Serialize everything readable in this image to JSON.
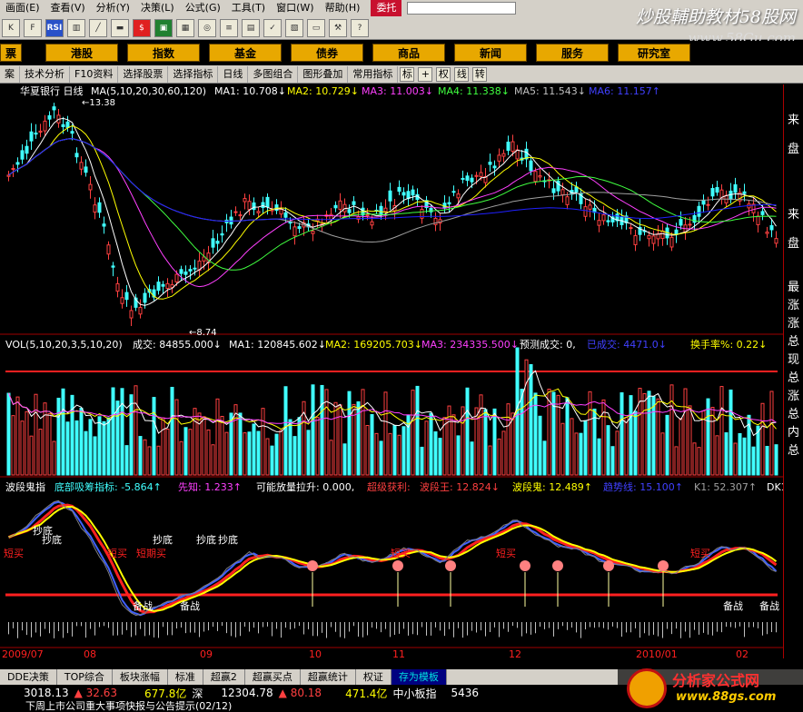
{
  "menu": [
    "画面(E)",
    "查看(V)",
    "分析(Y)",
    "决策(L)",
    "公式(G)",
    "工具(T)",
    "窗口(W)",
    "帮助(H)",
    "委托"
  ],
  "watermark_top": {
    "line1": "炒股輔助教材58股网",
    "line2": "www.58Gu.com"
  },
  "categories": [
    "票",
    "港股",
    "指数",
    "基金",
    "债券",
    "商品",
    "新闻",
    "服务",
    "研究室"
  ],
  "chart_toolbar": [
    "案",
    "技术分析",
    "F10资料",
    "选择股票",
    "选择指标",
    "日线",
    "多图组合",
    "图形叠加",
    "常用指标",
    "标",
    "权",
    "线",
    "转"
  ],
  "price_header": {
    "name": "华夏银行 日线",
    "ma_params": "MA(5,10,20,30,60,120)",
    "ma1": "MA1: 10.708↓",
    "ma2": "MA2: 10.729↓",
    "ma3": "MA3: 11.003↓",
    "ma4": "MA4: 11.338↓",
    "ma5": "MA5: 11.543↓",
    "ma6": "MA6: 11.157↑",
    "high_label": "←13.38",
    "low_label": "←8.74"
  },
  "vol_header": {
    "params": "VOL(5,10,20,3,5,10,20)",
    "vol": "成交: 84855.000↓",
    "ma1": "MA1: 120845.602↓",
    "ma2": "MA2: 169205.703↓",
    "ma3": "MA3: 234335.500↓",
    "forecast": "预测成交: 0,",
    "hidden": "已成交: 4471.0↓",
    "turnover": "换手率%: 0.22↓"
  },
  "ind_header": {
    "name": "波段鬼指",
    "a": "底部吸筹指标: -5.864↑",
    "b": "先知: 1.233↑",
    "c": "可能放量拉升: 0.000,",
    "d": "超级获利: ",
    "e": "波段王: 12.824↓",
    "f": "波段鬼: 12.489↑",
    "g": "趋势线: 15.100↑",
    "h": "K1: 52.307↑",
    "i": "DK1"
  },
  "ind_labels": [
    "抄底",
    "抄底",
    "抄底",
    "抄底",
    "抄底",
    "短买",
    "短买",
    "短期买",
    "短买",
    "短买",
    "短买",
    "备战",
    "备战",
    "备战",
    "备战"
  ],
  "x_dates": [
    "2009/07",
    "08",
    "09",
    "10",
    "11",
    "12",
    "2010/01",
    "02"
  ],
  "right_side": [
    "来",
    "盘",
    "来",
    "盘",
    "最",
    "涨",
    "涨",
    "总",
    "现",
    "总",
    "涨",
    "总",
    "内",
    "总"
  ],
  "tabs": [
    "DDE决策",
    "TOP综合",
    "板块涨幅",
    "标准",
    "超赢2",
    "超赢买点",
    "超赢统计",
    "权证",
    "存为模板"
  ],
  "ticker": {
    "v1": "3018.13",
    "v2": "▲ 32.63",
    "v3": "677.8亿",
    "v4": "深",
    "v5": "12304.78",
    "v6": "▲ 80.18",
    "v7": "471.4亿",
    "v8": "中小板指",
    "v9": "5436"
  },
  "scroll_text": "下周上市公司重大事项快报与公告提示(02/12)",
  "watermark_bottom": {
    "line1": "分析家公式网",
    "line2": "www.88gs.com"
  },
  "colors": {
    "up": "#ff4040",
    "down": "#40ffff",
    "ma1": "#ffffff",
    "ma2": "#ffff00",
    "ma3": "#ff40ff",
    "ma4": "#40ff40",
    "ma5": "#a0a0a0",
    "ma6": "#2020ff"
  }
}
